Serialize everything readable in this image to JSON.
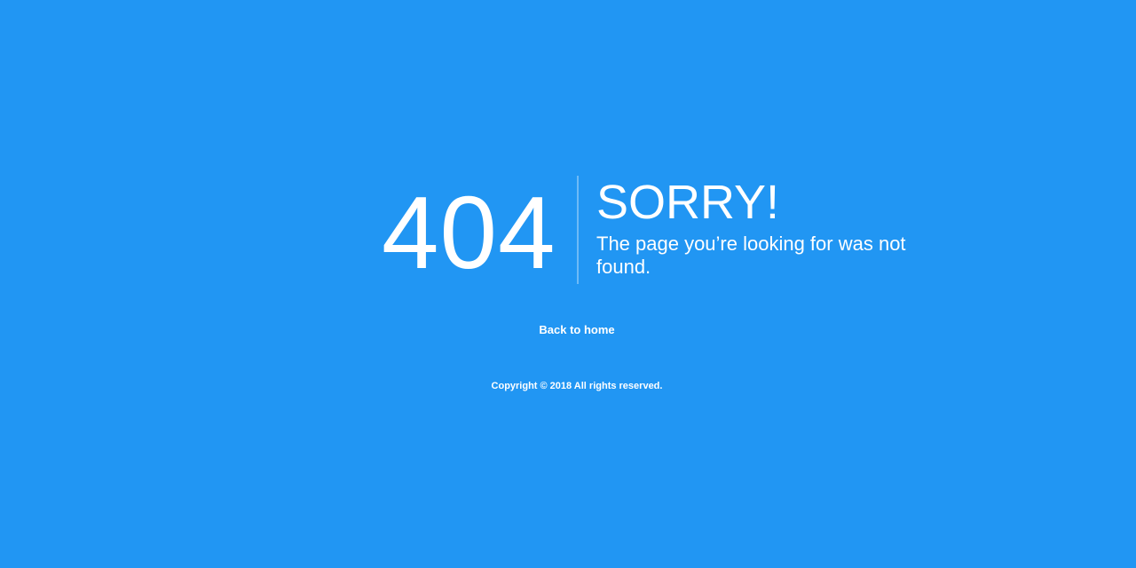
{
  "error": {
    "code": "404",
    "headline": "SORRY!",
    "message": "The page you’re looking for was not found."
  },
  "navigation": {
    "home_link_label": "Back to home"
  },
  "footer": {
    "copyright": "Copyright © 2018 All rights reserved."
  },
  "colors": {
    "background": "#2196f3",
    "text": "#ffffff"
  }
}
